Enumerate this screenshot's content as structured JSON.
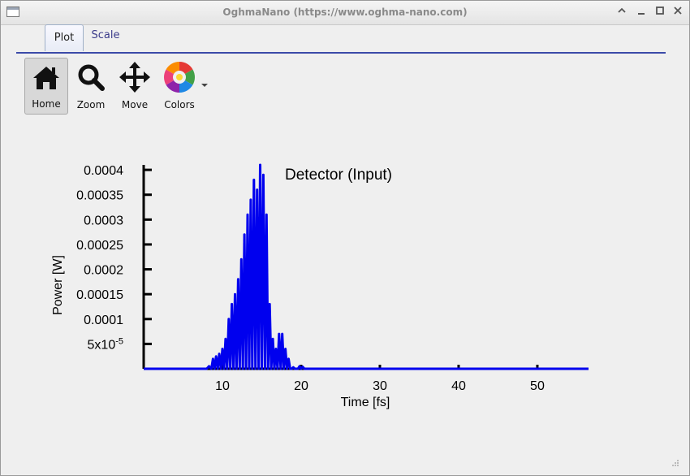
{
  "window": {
    "title": "OghmaNano (https://www.oghma-nano.com)"
  },
  "tabs": [
    {
      "label": "Plot"
    },
    {
      "label": "Scale"
    }
  ],
  "toolbar": {
    "home_label": "Home",
    "zoom_label": "Zoom",
    "move_label": "Move",
    "colors_label": "Colors"
  },
  "chart_data": {
    "type": "line",
    "title": "Detector (Input)",
    "xlabel": "Time [fs]",
    "ylabel": "Power [W]",
    "xlim": [
      0,
      56.5
    ],
    "ylim": [
      0,
      0.00041
    ],
    "x_ticks": [
      10,
      20,
      30,
      40,
      50
    ],
    "x_tick_labels": [
      "10",
      "20",
      "30",
      "40",
      "50"
    ],
    "y_ticks": [
      5e-05,
      0.0001,
      0.00015,
      0.0002,
      0.00025,
      0.0003,
      0.00035,
      0.0004
    ],
    "y_tick_labels": [
      "5x10-5",
      "0.0001",
      "0.00015",
      "0.0002",
      "0.00025",
      "0.0003",
      "0.00035",
      "0.0004"
    ],
    "grid": false,
    "series": [
      {
        "color": "#0000ee",
        "x": [
          0,
          8,
          8.3,
          8.6,
          8.8,
          9.0,
          9.2,
          9.4,
          9.6,
          9.8,
          10.0,
          10.2,
          10.4,
          10.6,
          10.8,
          11.0,
          11.2,
          11.4,
          11.6,
          11.8,
          12.0,
          12.2,
          12.4,
          12.6,
          12.8,
          13.0,
          13.2,
          13.4,
          13.6,
          13.8,
          14.0,
          14.2,
          14.4,
          14.6,
          14.8,
          15.0,
          15.2,
          15.4,
          15.6,
          15.8,
          16.0,
          16.2,
          16.4,
          16.6,
          16.8,
          17.0,
          17.2,
          17.4,
          17.6,
          17.8,
          18.0,
          18.2,
          18.4,
          18.6,
          18.8,
          19.0,
          19.2,
          19.4,
          19.6,
          19.8,
          20.0,
          20.2,
          20.4,
          20.6,
          20.8,
          21.0,
          56.5
        ],
        "y": [
          0,
          0,
          5e-06,
          0,
          2e-05,
          0,
          2.5e-05,
          0,
          3e-05,
          0,
          4e-05,
          0,
          6e-05,
          0,
          0.0001,
          0,
          0.00013,
          0,
          0.00015,
          0,
          0.00018,
          0,
          0.00022,
          0,
          0.00027,
          0,
          0.00031,
          0,
          0.00034,
          0,
          0.00038,
          0,
          0.00036,
          0,
          0.00041,
          0,
          0.00039,
          0,
          0.00031,
          0,
          0.00013,
          0,
          6e-05,
          0,
          4e-05,
          0,
          7e-05,
          0,
          7e-05,
          0,
          4e-05,
          0,
          2e-05,
          0,
          0,
          3e-06,
          0,
          0,
          0,
          5e-06,
          0,
          4e-06,
          0,
          0,
          0,
          0,
          0
        ]
      }
    ]
  }
}
